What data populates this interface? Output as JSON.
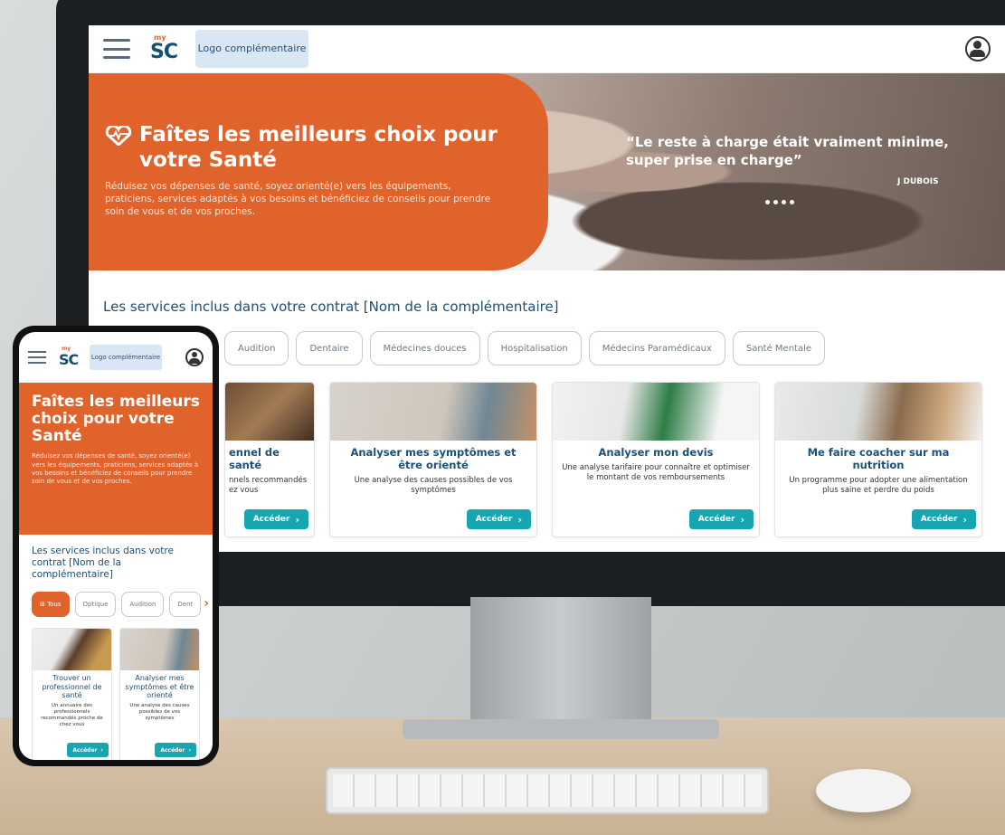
{
  "colors": {
    "brand_orange": "#e0632c",
    "accent_teal": "#17a6b0",
    "navy": "#1e4e73"
  },
  "logo": {
    "my": "my",
    "sc": "SC",
    "complementary": "Logo complémentaire"
  },
  "hero": {
    "title": "Faîtes les meilleurs choix pour votre Santé",
    "text": "Réduisez vos dépenses de santé, soyez orienté(e) vers les équipements, praticiens, services adaptés à vos besoins et bénéficiez de conseils pour prendre soin de vous et de vos proches.",
    "quote": "“Le reste à charge était vraiment minime, super prise en charge”",
    "quote_author": "J DUBOIS"
  },
  "services_title": "Les services inclus dans votre contrat [Nom de la complémentaire]",
  "chips": [
    "Tous",
    "Optique",
    "Audition",
    "Dentaire",
    "Médecines douces",
    "Hospitalisation",
    "Médecins Paramédicaux",
    "Santé Mentale"
  ],
  "desktop_chips": [
    "Audition",
    "Dentaire",
    "Médecines douces",
    "Hospitalisation",
    "Médecins Paramédicaux",
    "Santé Mentale"
  ],
  "cards": [
    {
      "title": "Trouver un professionnel de santé",
      "desc": "Un annuaire des professionnels recommandés proche de chez vous"
    },
    {
      "title": "Analyser mes symptômes et être orienté",
      "desc": "Une analyse des causes possibles de vos symptômes"
    },
    {
      "title": "Analyser mon devis",
      "desc": "Une analyse tarifaire pour connaître et optimiser le montant de vos remboursements"
    },
    {
      "title": "Me faire coacher sur ma nutrition",
      "desc": "Un programme pour adopter une alimentation plus saine et perdre du poids"
    }
  ],
  "desktop_card1_title": "ennel de santé",
  "desktop_card1_desc": "nnels recommandés ez vous",
  "access_label": "Accéder",
  "phone": {
    "chips": [
      "Tous",
      "Optique",
      "Audition",
      "Dent"
    ]
  }
}
